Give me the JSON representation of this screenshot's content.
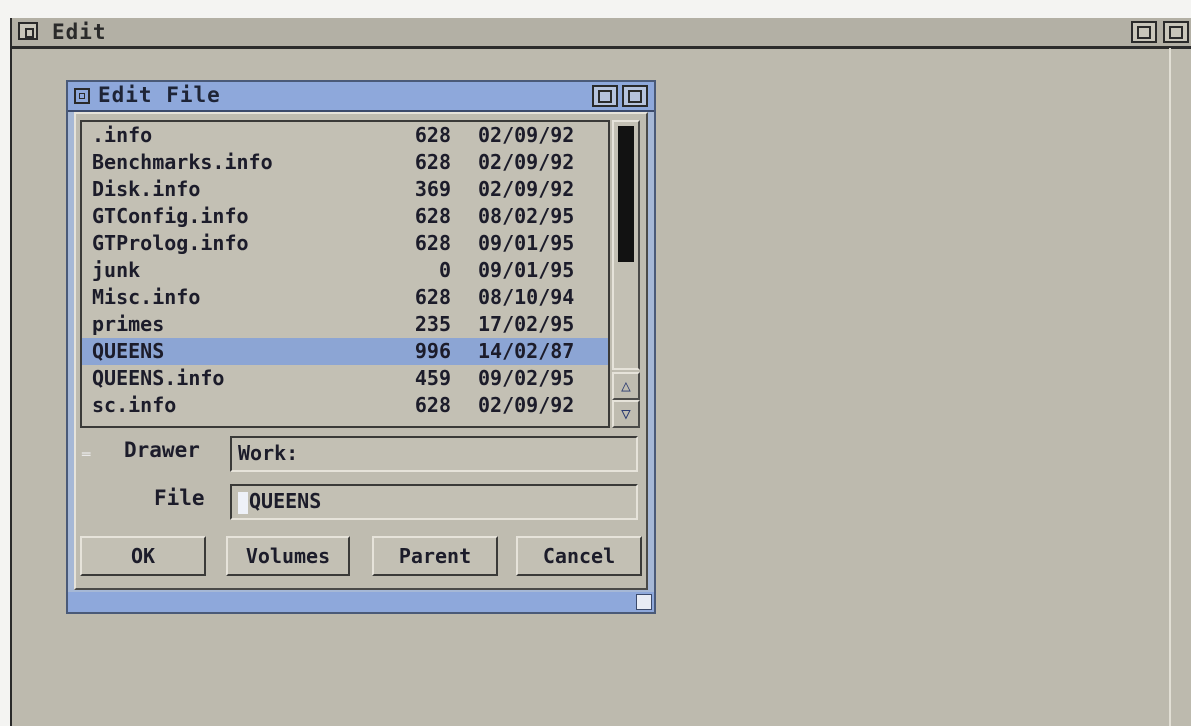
{
  "main_window": {
    "title": "Edit"
  },
  "dialog": {
    "title": "Edit File",
    "files": [
      {
        "name": ".info",
        "size": "628",
        "date": "02/09/92"
      },
      {
        "name": "Benchmarks.info",
        "size": "628",
        "date": "02/09/92"
      },
      {
        "name": "Disk.info",
        "size": "369",
        "date": "02/09/92"
      },
      {
        "name": "GTConfig.info",
        "size": "628",
        "date": "08/02/95"
      },
      {
        "name": "GTProlog.info",
        "size": "628",
        "date": "09/01/95"
      },
      {
        "name": "junk",
        "size": "0",
        "date": "09/01/95"
      },
      {
        "name": "Misc.info",
        "size": "628",
        "date": "08/10/94"
      },
      {
        "name": "primes",
        "size": "235",
        "date": "17/02/95"
      },
      {
        "name": "QUEENS",
        "size": "996",
        "date": "14/02/87"
      },
      {
        "name": "QUEENS.info",
        "size": "459",
        "date": "09/02/95"
      },
      {
        "name": "sc.info",
        "size": "628",
        "date": "02/09/92"
      }
    ],
    "selected_file": "QUEENS",
    "drawer_label": "Drawer",
    "drawer_value": "Work:",
    "file_label": "File",
    "file_value": "QUEENS",
    "buttons": {
      "ok": "OK",
      "volumes": "Volumes",
      "parent": "Parent",
      "cancel": "Cancel"
    }
  },
  "colors": {
    "dialog_titlebar": "#8ea8db",
    "selection": "#8ca5d4",
    "panel": "#bfbcb0"
  }
}
